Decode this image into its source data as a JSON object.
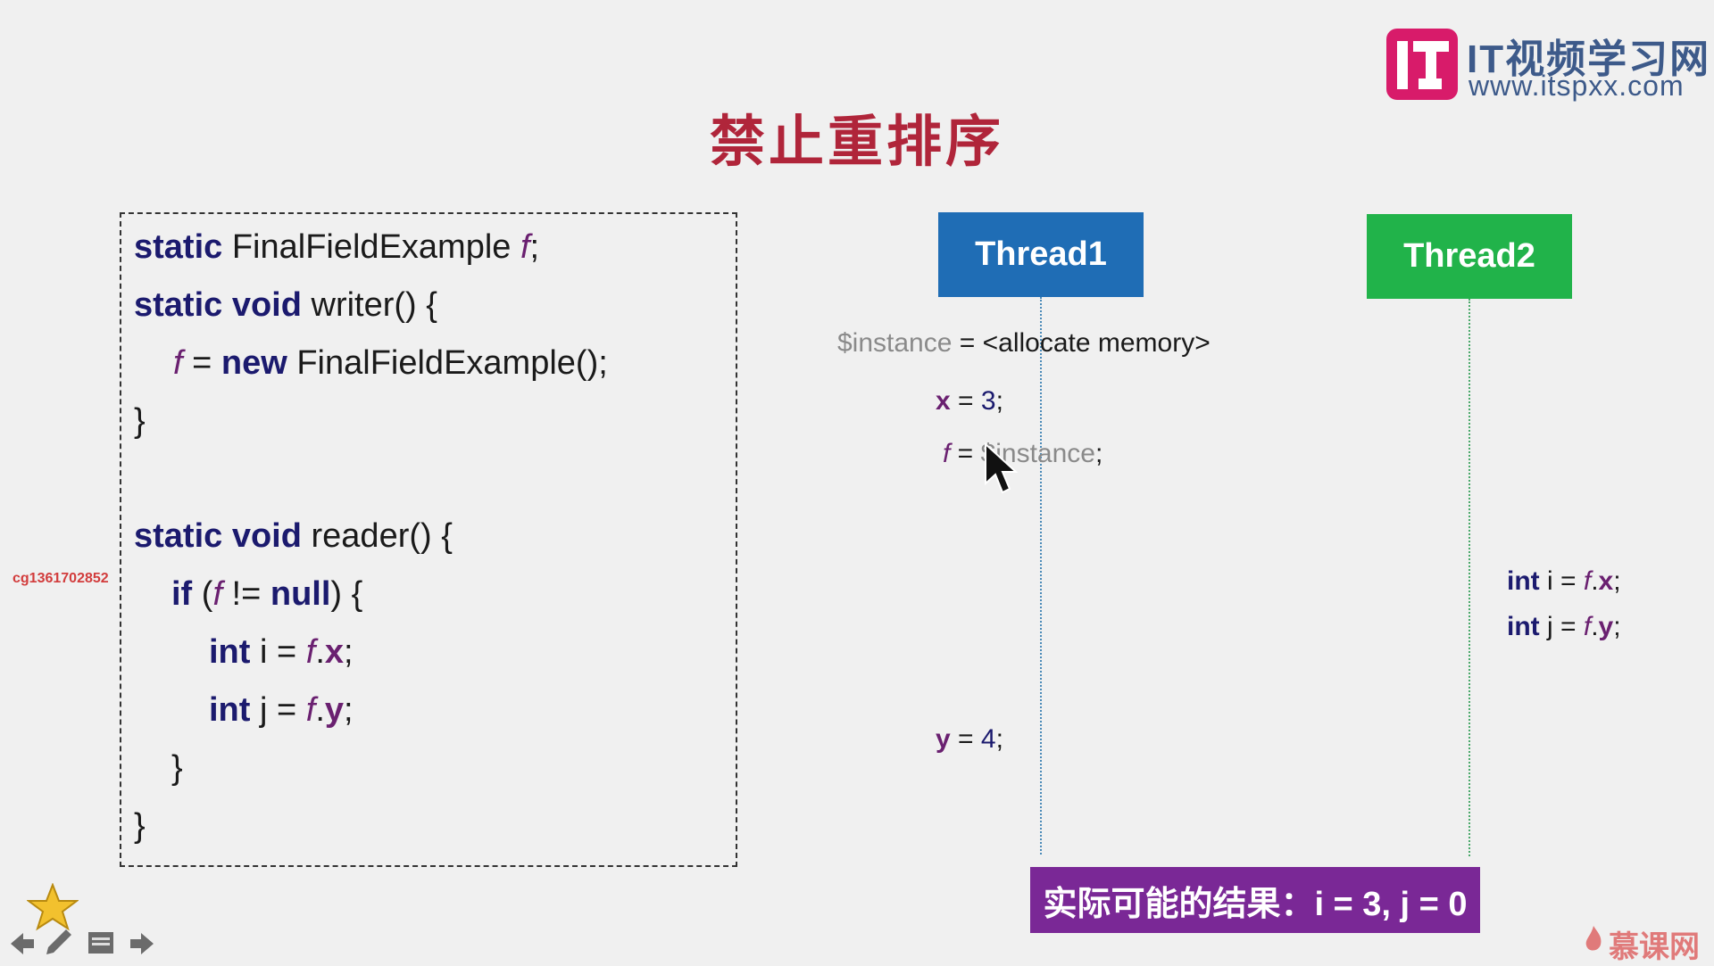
{
  "logo": {
    "title": "IT视频学习网",
    "url": "www.itspxx.com",
    "colors": {
      "mark": "#d81b6a",
      "text": "#3d5a8a"
    }
  },
  "title": "禁止重排序",
  "code": {
    "l1": {
      "kw": "static",
      "type": " FinalFieldExample ",
      "var": "f",
      "end": ";"
    },
    "l2": {
      "kw": "static void",
      "rest": " writer() {"
    },
    "l3": {
      "var": "f",
      "mid": " = ",
      "kw": "new",
      "rest": " FinalFieldExample();"
    },
    "l4": {
      "text": "}"
    },
    "l5": {
      "kw": "static void",
      "rest": " reader() {"
    },
    "l6": {
      "kw": "if",
      "open": " (",
      "var": "f",
      "mid": " != ",
      "kw2": "null",
      "rest": ") {"
    },
    "l7": {
      "kw": "int",
      "mid": " i = ",
      "var": "f",
      "dot": ".",
      "fld": "x",
      "end": ";"
    },
    "l8": {
      "kw": "int",
      "mid": " j = ",
      "var": "f",
      "dot": ".",
      "fld": "y",
      "end": ";"
    },
    "l9": {
      "text": "}"
    },
    "l10": {
      "text": "}"
    }
  },
  "threads": {
    "t1": {
      "label": "Thread1",
      "color": "#1f6db5"
    },
    "t2": {
      "label": "Thread2",
      "color": "#21b34a"
    }
  },
  "thread1_ops": {
    "s1": {
      "lhs": "$instance",
      "rhs": " = <allocate memory>"
    },
    "s2": {
      "fld": "x",
      "mid": " = ",
      "num": "3",
      "end": ";"
    },
    "s3": {
      "var": "f",
      "mid": " = ",
      "rhs": "$instance",
      "end": ";"
    },
    "s4": {
      "fld": "y",
      "mid": " = ",
      "num": "4",
      "end": ";"
    }
  },
  "thread2_ops": {
    "s1": {
      "kw": "int",
      "mid": " i = ",
      "var": "f",
      "dot": ".",
      "fld": "x",
      "end": ";"
    },
    "s2": {
      "kw": "int",
      "mid": " j = ",
      "var": "f",
      "dot": ".",
      "fld": "y",
      "end": ";"
    }
  },
  "result": "实际可能的结果：i = 3, j = 0",
  "watermark_id": "cg1361702852",
  "footer_brand": "慕课网",
  "colors": {
    "title": "#b0253a",
    "keyword": "#1b1a6e",
    "variable": "#6a2070",
    "result_bg": "#7a2896"
  }
}
